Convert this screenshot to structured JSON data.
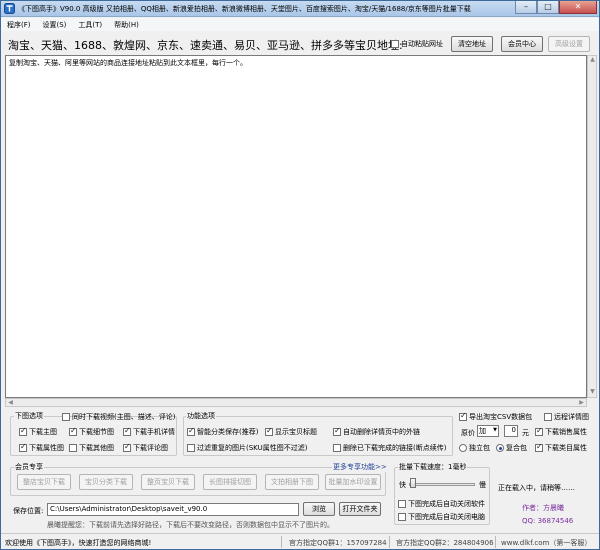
{
  "window": {
    "title": "《下图高手》V90.0 高级版 又拍相册、QQ相册、新浪爱拍相册、新浪微博相册、天堂图片、百度搜索图片、淘宝/天猫/1688/京东等图片批量下载",
    "controls": {
      "minimize": "–",
      "maximize": "□",
      "close": "✕"
    }
  },
  "menu": [
    "程序(F)",
    "设置(S)",
    "工具(T)",
    "帮助(H)"
  ],
  "address": {
    "label": "淘宝、天猫、1688、敦煌网、京东、速卖通、易贝、亚马逊、拼多多等宝贝地址:",
    "auto_paste": "自动粘贴网址",
    "clear_btn": "清空地址",
    "member_btn": "会员中心",
    "advanced_btn": "高级设置"
  },
  "textarea": {
    "content": "复制淘宝、天猫、阿里等网站的商品连接地址粘贴到此文本框里，每行一个。"
  },
  "download_options": {
    "title": "下图选项",
    "main_img": "下载主图",
    "detail_img": "下载细节图",
    "mobile_detail": "下载手机详情",
    "attr_img": "下载属性图",
    "other_img": "下载其他图",
    "review_img": "下载评论图",
    "video": "同时下载视频(主图、描述、评论)"
  },
  "function_options": {
    "title": "功能选项",
    "smart_save": "智能分类保存(推荐)",
    "show_title": "显示宝贝标题",
    "auto_delete_links": "自动删除详情页中的外链",
    "filter_dup": "过滤重复的图片(SKU属性图不过滤)",
    "delete_done": "删除已下载完成的链接(断点续传)"
  },
  "right_options": {
    "export_csv": "导出淘宝CSV数据包",
    "remote_detail": "远程详情图",
    "price_label": "原价",
    "price_op": "加",
    "price_value": "0",
    "price_unit": "元",
    "sales_attr": "下载销售属性",
    "standalone": "独立包",
    "combined": "复合包",
    "category_attr": "下载类目属性"
  },
  "member": {
    "title": "会员专享",
    "more": "更多专享功能>>",
    "buttons": [
      "整店宝贝下载",
      "宝贝分类下载",
      "整页宝贝下载",
      "长图排接切图",
      "文拍相册下图",
      "批量加水印设置"
    ]
  },
  "speed": {
    "label": "批量下载速度：1毫秒",
    "fast": "快",
    "slow": "慢",
    "close_app": "下图完成后自动关闭软件",
    "shutdown": "下图完成后自动关闭电脑",
    "level_fraction": 0.02
  },
  "status_panel": {
    "loading": "正在载入中，请稍等……",
    "author": "作者：方晨曦",
    "qq": "QQ: 36874546"
  },
  "save": {
    "label": "保存位置:",
    "path": "C:\\Users\\Administrator\\Desktop\\saveit_v90.0",
    "browse": "浏览",
    "open_folder": "打开文件夹",
    "tip": "晨曦提醒您：下载前请先选择好路径，下载后不要改变路径，否则数据包中显示不了图片的。"
  },
  "statusbar": {
    "welcome": "欢迎使用《下图高手》，快速打造您的网络商城!",
    "qq_group1": "官方指定QQ群1：157097284",
    "qq_group2": "官方指定QQ群2：284804906",
    "site": "www.dlkf.com（第一客服）"
  },
  "colors": {
    "titlebar": "#b9d1ee",
    "accent_blue": "#1c3f94",
    "accent_purple": "#7a2fa0"
  }
}
